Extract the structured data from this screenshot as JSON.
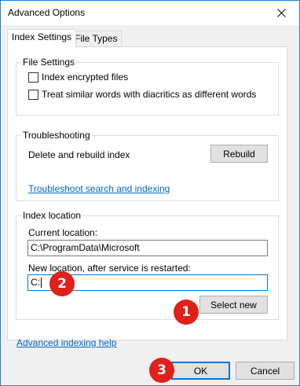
{
  "window": {
    "title": "Advanced Options"
  },
  "tabs": [
    {
      "label": "Index Settings",
      "active": true
    },
    {
      "label": "File Types",
      "active": false
    }
  ],
  "file_settings": {
    "title": "File Settings",
    "options": [
      {
        "label": "Index encrypted files",
        "checked": false
      },
      {
        "label": "Treat similar words with diacritics as different words",
        "checked": false
      }
    ]
  },
  "troubleshooting": {
    "title": "Troubleshooting",
    "description": "Delete and rebuild index",
    "rebuild_label": "Rebuild",
    "link_label": "Troubleshoot search and indexing"
  },
  "index_location": {
    "title": "Index location",
    "current_label": "Current location:",
    "current_value": "C:\\ProgramData\\Microsoft",
    "new_label": "New location, after service is restarted:",
    "new_value": "C:",
    "select_new_label": "Select new"
  },
  "footer": {
    "help_link": "Advanced indexing help",
    "ok_label": "OK",
    "cancel_label": "Cancel"
  },
  "markers": {
    "one": "1",
    "two": "2",
    "three": "3"
  },
  "colors": {
    "accent": "#0078d7",
    "marker": "#e0201b",
    "link": "#0066cc"
  },
  "icons": {
    "close": "close-icon"
  }
}
